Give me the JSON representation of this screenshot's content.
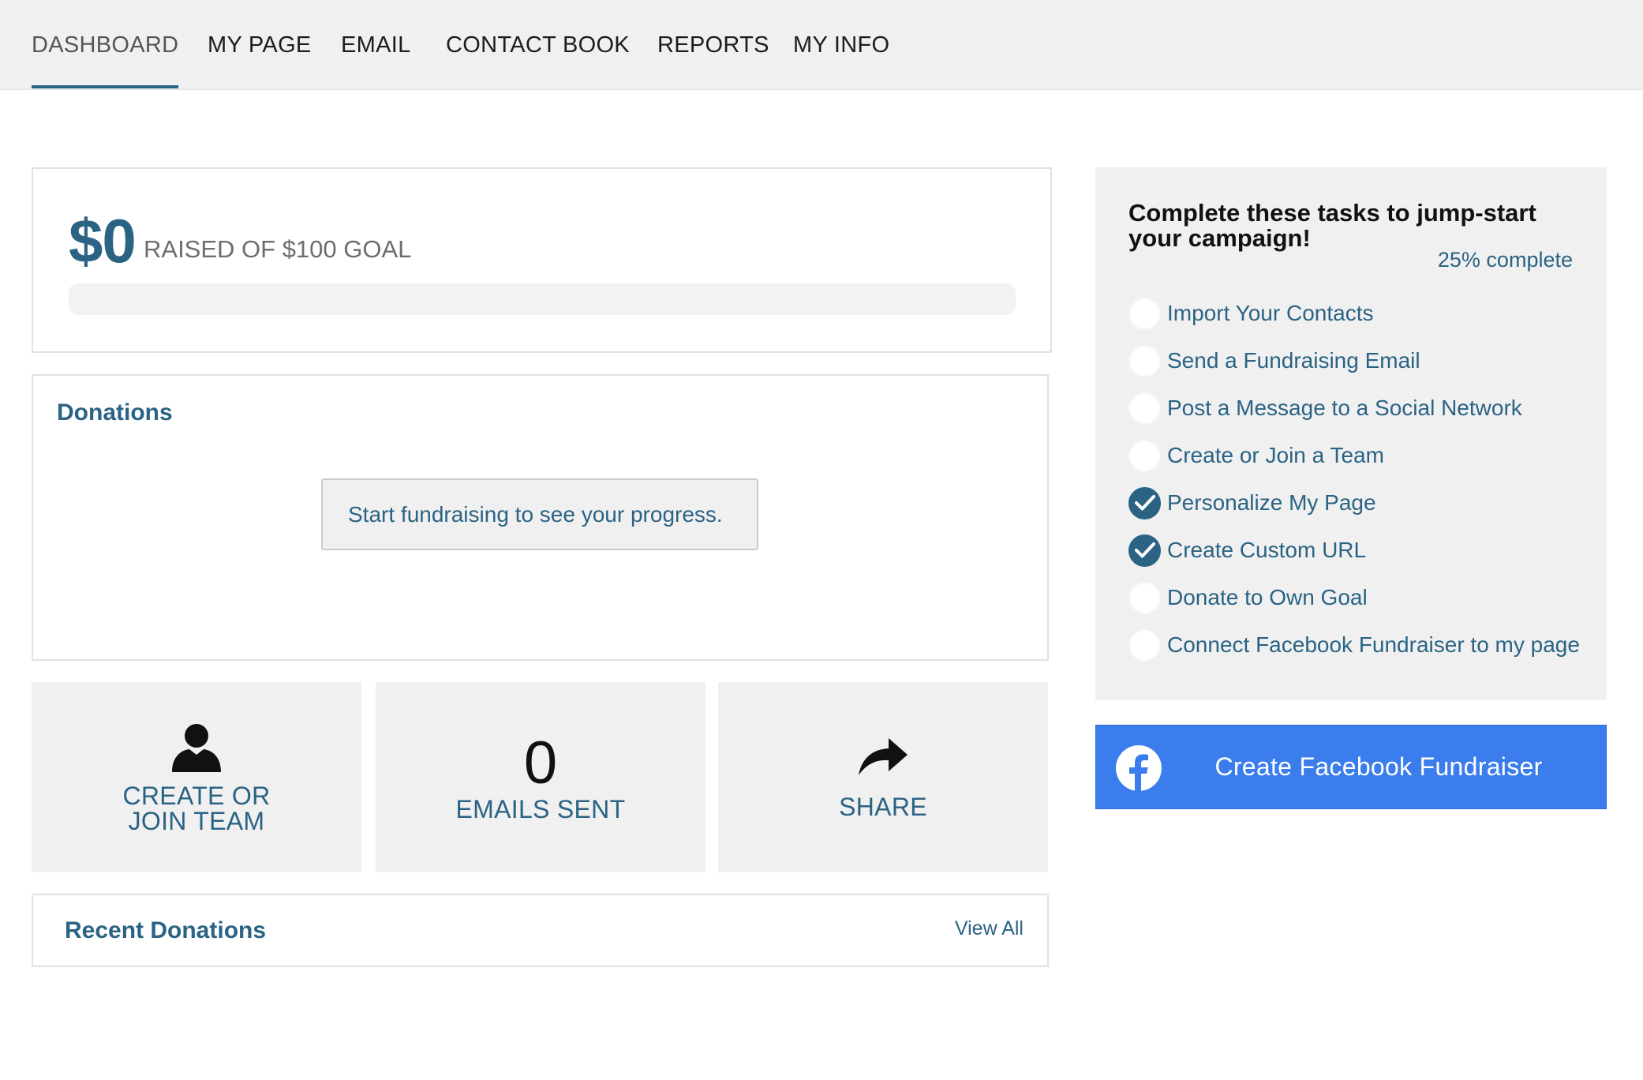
{
  "nav": {
    "tabs": [
      {
        "label": "DASHBOARD",
        "active": true
      },
      {
        "label": "MY PAGE"
      },
      {
        "label": "EMAIL"
      },
      {
        "label": "CONTACT BOOK"
      },
      {
        "label": "REPORTS"
      },
      {
        "label": "MY INFO"
      }
    ]
  },
  "goal": {
    "amount": "$0",
    "text": "RAISED OF $100 GOAL",
    "progress_fraction": 0
  },
  "donations": {
    "title": "Donations",
    "empty_message": "Start fundraising to see your progress."
  },
  "tiles": {
    "team": {
      "line1": "CREATE OR",
      "line2": "JOIN TEAM",
      "icon": "user-icon"
    },
    "emails": {
      "count": "0",
      "label": "EMAILS SENT"
    },
    "share": {
      "label": "SHARE",
      "icon": "share-arrow-icon"
    }
  },
  "recent": {
    "title": "Recent Donations",
    "view_all": "View All"
  },
  "tasks": {
    "heading": "Complete these tasks to jump-start your campaign!",
    "percent": "25% complete",
    "items": [
      {
        "label": "Import Your Contacts",
        "done": false
      },
      {
        "label": "Send a Fundraising Email",
        "done": false
      },
      {
        "label": "Post a Message to a Social Network",
        "done": false
      },
      {
        "label": "Create or Join a Team",
        "done": false
      },
      {
        "label": "Personalize My Page",
        "done": true
      },
      {
        "label": "Create Custom URL",
        "done": true
      },
      {
        "label": "Donate to Own Goal",
        "done": false
      },
      {
        "label": "Connect Facebook Fundraiser to my page",
        "done": false
      }
    ]
  },
  "facebook": {
    "label": "Create Facebook Fundraiser",
    "icon": "facebook-icon"
  },
  "colors": {
    "accent": "#2a6384",
    "facebook": "#3b7ded",
    "panel": "#f0f0f0"
  }
}
